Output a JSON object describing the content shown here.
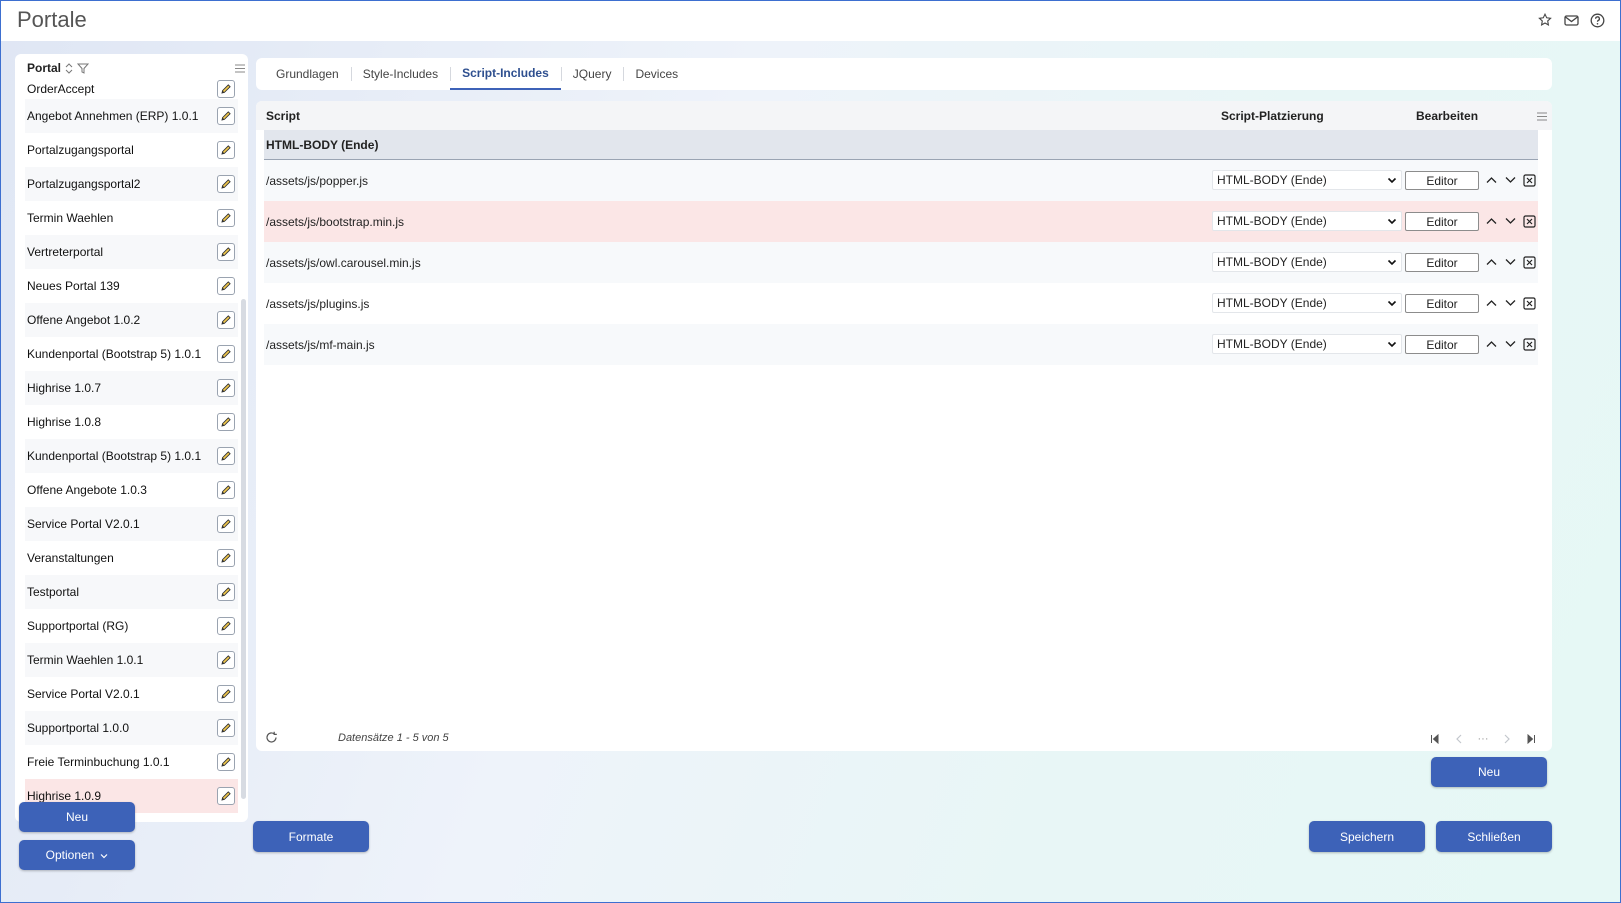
{
  "app": {
    "title": "Portale"
  },
  "sidebar": {
    "header": "Portal",
    "items": [
      {
        "label": "OrderAccept"
      },
      {
        "label": "Angebot Annehmen (ERP) 1.0.1"
      },
      {
        "label": "Portalzugangsportal"
      },
      {
        "label": "Portalzugangsportal2"
      },
      {
        "label": "Termin Waehlen"
      },
      {
        "label": "Vertreterportal"
      },
      {
        "label": "Neues Portal 139"
      },
      {
        "label": "Offene Angebot 1.0.2"
      },
      {
        "label": "Kundenportal (Bootstrap 5) 1.0.1"
      },
      {
        "label": "Highrise 1.0.7"
      },
      {
        "label": "Highrise 1.0.8"
      },
      {
        "label": "Kundenportal (Bootstrap 5) 1.0.1"
      },
      {
        "label": "Offene Angebote 1.0.3"
      },
      {
        "label": "Service Portal V2.0.1"
      },
      {
        "label": "Veranstaltungen"
      },
      {
        "label": "Testportal"
      },
      {
        "label": "Supportportal (RG)"
      },
      {
        "label": "Termin Waehlen 1.0.1"
      },
      {
        "label": "Service Portal V2.0.1"
      },
      {
        "label": "Supportportal 1.0.0"
      },
      {
        "label": "Freie Terminbuchung 1.0.1"
      },
      {
        "label": "Highrise 1.0.9"
      }
    ],
    "selected_index": 21,
    "new_label": "Neu",
    "options_label": "Optionen"
  },
  "tabs": [
    {
      "label": "Grundlagen"
    },
    {
      "label": "Style-Includes"
    },
    {
      "label": "Script-Includes"
    },
    {
      "label": "JQuery"
    },
    {
      "label": "Devices"
    }
  ],
  "active_tab": 2,
  "grid": {
    "columns": {
      "script": "Script",
      "placement": "Script-Platzierung",
      "edit": "Bearbeiten"
    },
    "group_label": "HTML-BODY (Ende)",
    "rows": [
      {
        "path": "/assets/js/popper.js",
        "placement": "HTML-BODY (Ende)",
        "editor": "Editor"
      },
      {
        "path": "/assets/js/bootstrap.min.js",
        "placement": "HTML-BODY (Ende)",
        "editor": "Editor"
      },
      {
        "path": "/assets/js/owl.carousel.min.js",
        "placement": "HTML-BODY (Ende)",
        "editor": "Editor"
      },
      {
        "path": "/assets/js/plugins.js",
        "placement": "HTML-BODY (Ende)",
        "editor": "Editor"
      },
      {
        "path": "/assets/js/mf-main.js",
        "placement": "HTML-BODY (Ende)",
        "editor": "Editor"
      }
    ],
    "highlighted_row": 1,
    "footer": {
      "count": "Datensätze 1 - 5 von 5",
      "ellipsis": "···"
    }
  },
  "actions": {
    "grid_new": "Neu",
    "formats": "Formate",
    "save": "Speichern",
    "close": "Schließen"
  }
}
